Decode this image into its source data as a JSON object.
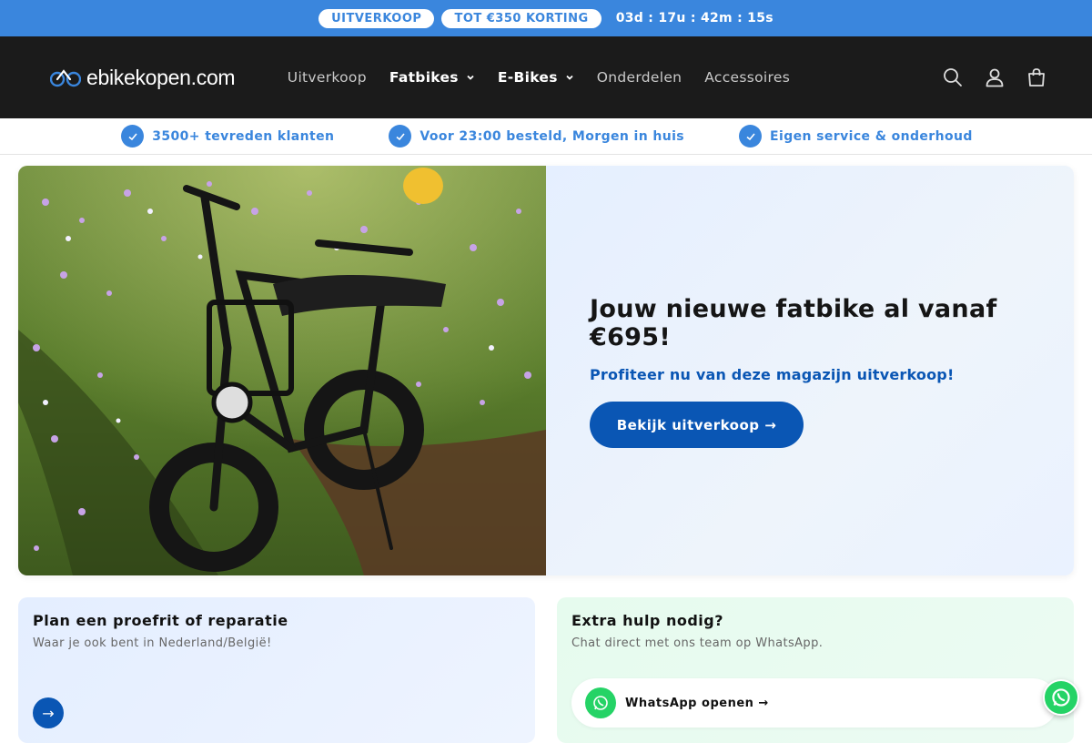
{
  "announcement": {
    "badge_1": "UITVERKOOP",
    "badge_2": "TOT €350 KORTING",
    "countdown": "03d : 17u : 42m : 15s",
    "bg_color": "#3a86dd"
  },
  "header": {
    "logo_text": "ebikekopen.com",
    "nav": [
      {
        "label": "Uitverkoop"
      },
      {
        "label": "Fatbikes"
      },
      {
        "label": "E-Bikes"
      },
      {
        "label": "Onderdelen"
      },
      {
        "label": "Accessoires"
      }
    ],
    "icons": [
      "search-icon",
      "account-icon",
      "cart-icon"
    ]
  },
  "usp": [
    {
      "label": "3500+ tevreden klanten"
    },
    {
      "label": "Voor 23:00 besteld, Morgen in huis"
    },
    {
      "label": "Eigen service & onderhoud"
    }
  ],
  "hero": {
    "title": "Jouw nieuwe fatbike al vanaf €695!",
    "subtitle": "Profiteer nu van deze magazijn uitverkoop!",
    "button_label": "Bekijk uitverkoop →",
    "accent_color": "#0a56b4"
  },
  "cards": {
    "left": {
      "title": "Plan een proefrit of reparatie",
      "subtitle": "Waar je ook bent in Nederland/België!",
      "arrow": "→"
    },
    "right": {
      "title": "Extra hulp nodig?",
      "subtitle": "Chat direct met ons team op WhatsApp.",
      "button_label": "WhatsApp openen →"
    }
  }
}
